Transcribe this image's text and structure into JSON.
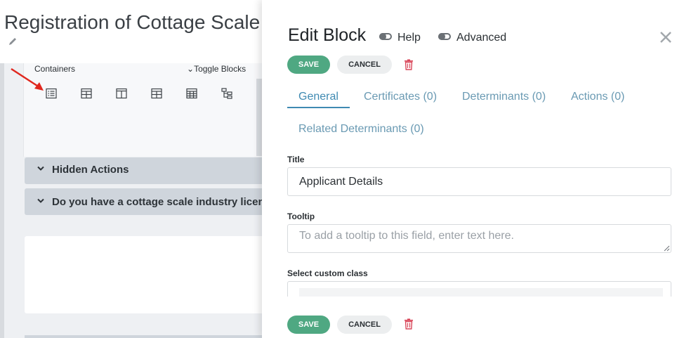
{
  "background_page": {
    "title": "Registration of Cottage Scale In",
    "containers_label": "Containers",
    "toggle_blocks_label": "Toggle Blocks",
    "container_icons": [
      "list-icon",
      "grid-icon",
      "columns-icon",
      "grid-icon",
      "table-icon",
      "tree-icon"
    ],
    "accordions": [
      {
        "label": "Hidden Actions"
      },
      {
        "label": "Do you have a cottage scale industry licen"
      }
    ]
  },
  "drawer": {
    "title": "Edit Block",
    "help_label": "Help",
    "advanced_label": "Advanced",
    "save_label": "SAVE",
    "cancel_label": "CANCEL",
    "tabs": [
      {
        "label": "General",
        "active": true
      },
      {
        "label": "Certificates (0)"
      },
      {
        "label": "Determinants (0)"
      },
      {
        "label": "Actions (0)"
      },
      {
        "label": "Related Determinants (0)"
      }
    ],
    "fields": {
      "title_label": "Title",
      "title_value": "Applicant Details",
      "tooltip_label": "Tooltip",
      "tooltip_placeholder": "To add a tooltip to this field, enter text here.",
      "custom_class_label": "Select custom class"
    }
  },
  "colors": {
    "save_button": "#4fa882",
    "tab_active": "#3f8ab2",
    "tab_inactive": "#6a9ab3",
    "delete_icon": "#d9475a",
    "annotation_arrow": "#e0281f"
  }
}
